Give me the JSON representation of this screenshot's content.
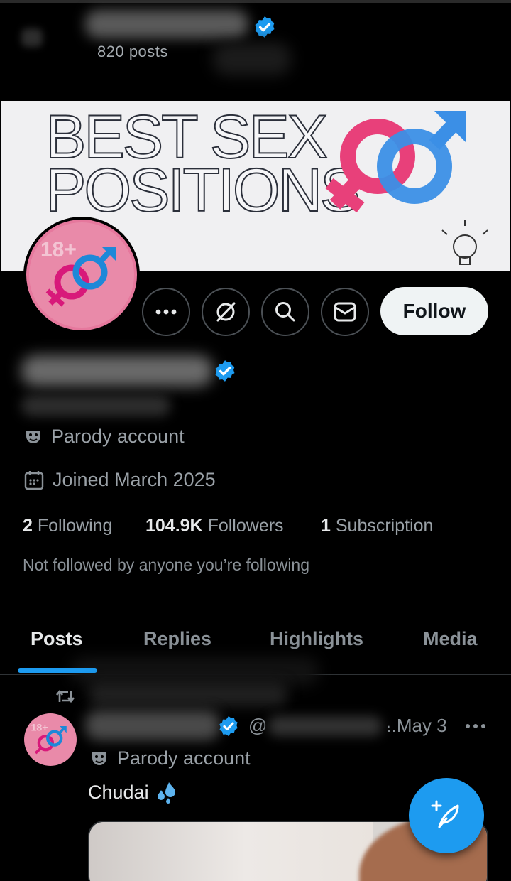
{
  "header": {
    "posts_count": "820 posts"
  },
  "profile": {
    "banner_line_1": "BEST SEX",
    "banner_line_2": "POSITIONS",
    "follow_label": "Follow",
    "label": "Parody account",
    "joined": "Joined March 2025",
    "stats": {
      "following_count": "2",
      "following_label": "Following",
      "followers_count": "104.9K",
      "followers_label": "Followers",
      "subscriptions_count": "1",
      "subscriptions_label": "Subscription"
    },
    "not_followed_text": "Not followed by anyone you’re following"
  },
  "tabs": [
    {
      "label": "Posts",
      "active": true
    },
    {
      "label": "Replies",
      "active": false
    },
    {
      "label": "Highlights",
      "active": false
    },
    {
      "label": "Media",
      "active": false
    }
  ],
  "post": {
    "handle_prefix": "@",
    "handle_suffix": "..",
    "date": "· May 3",
    "label": "Parody account",
    "text": "Chudai"
  },
  "colors": {
    "accent": "#1d9bf0",
    "background": "#000000",
    "pink": "#e8407a",
    "blue": "#2f8de0"
  },
  "icons": [
    "back-arrow-icon",
    "verified-badge-icon",
    "more-icon",
    "grok-icon",
    "search-icon",
    "mail-icon",
    "parody-mask-icon",
    "calendar-icon",
    "retweet-icon",
    "sweat-droplets-icon",
    "compose-icon"
  ]
}
